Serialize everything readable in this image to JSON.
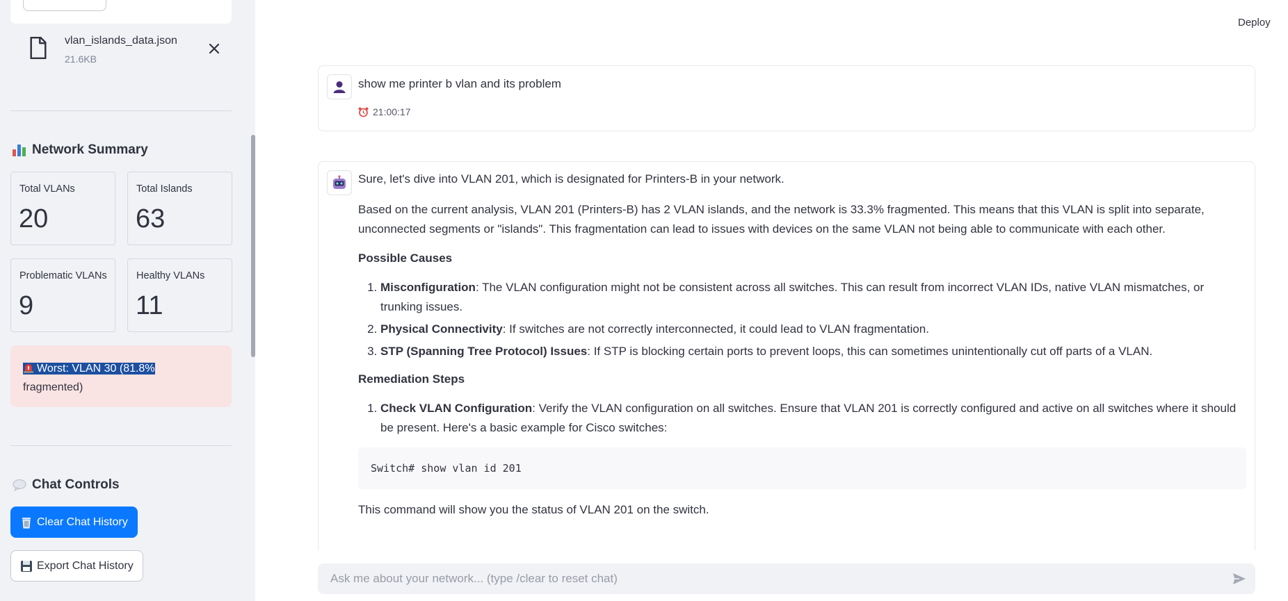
{
  "sidebar": {
    "file": {
      "name": "vlan_islands_data.json",
      "size": "21.6KB"
    },
    "summary_title": "Network Summary",
    "metrics": [
      {
        "label": "Total VLANs",
        "value": "20"
      },
      {
        "label": "Total Islands",
        "value": "63"
      },
      {
        "label": "Problematic VLANs",
        "value": "9"
      },
      {
        "label": "Healthy VLANs",
        "value": "11"
      }
    ],
    "alert": {
      "highlight": "Worst: VLAN 30 (81.8%",
      "rest": "fragmented)"
    },
    "chat_controls_title": "Chat Controls",
    "clear_button": "Clear Chat History",
    "export_button": "Export Chat History"
  },
  "header": {
    "deploy": "Deploy"
  },
  "chat": {
    "user_message": {
      "text": "show me printer b vlan and its problem",
      "time": "21:00:17"
    },
    "assistant_message": {
      "intro": "Sure, let's dive into VLAN 201, which is designated for Printers-B in your network.",
      "analysis": "Based on the current analysis, VLAN 201 (Printers-B) has 2 VLAN islands, and the network is 33.3% fragmented. This means that this VLAN is split into separate, unconnected segments or \"islands\". This fragmentation can lead to issues with devices on the same VLAN not being able to communicate with each other.",
      "causes_heading": "Possible Causes",
      "causes": [
        {
          "title": "Misconfiguration",
          "text": ": The VLAN configuration might not be consistent across all switches. This can result from incorrect VLAN IDs, native VLAN mismatches, or trunking issues."
        },
        {
          "title": "Physical Connectivity",
          "text": ": If switches are not correctly interconnected, it could lead to VLAN fragmentation."
        },
        {
          "title": "STP (Spanning Tree Protocol) Issues",
          "text": ": If STP is blocking certain ports to prevent loops, this can sometimes unintentionally cut off parts of a VLAN."
        }
      ],
      "remediation_heading": "Remediation Steps",
      "steps": [
        {
          "title": "Check VLAN Configuration",
          "text": ": Verify the VLAN configuration on all switches. Ensure that VLAN 201 is correctly configured and active on all switches where it should be present. Here's a basic example for Cisco switches:"
        }
      ],
      "code": "Switch# show vlan id 201",
      "after_code": "This command will show you the status of VLAN 201 on the switch."
    }
  },
  "input": {
    "placeholder": "Ask me about your network... (type /clear to reset chat)"
  }
}
